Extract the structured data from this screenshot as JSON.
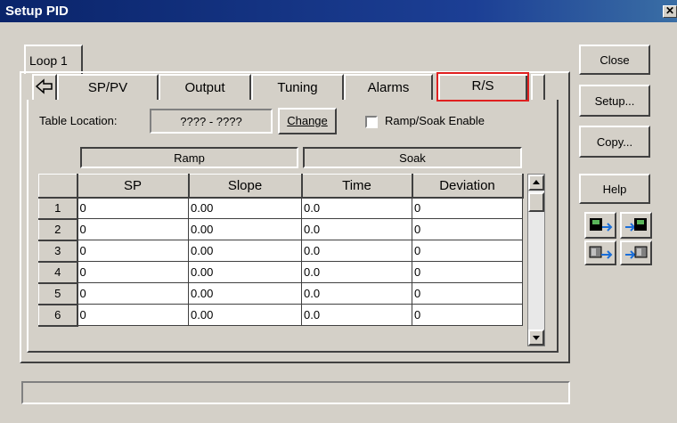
{
  "window": {
    "title": "Setup PID"
  },
  "loop_tab": {
    "label": "Loop 1"
  },
  "tabs": {
    "back_icon": "back-arrow-icon",
    "items": [
      {
        "label": "SP/PV"
      },
      {
        "label": "Output"
      },
      {
        "label": "Tuning"
      },
      {
        "label": "Alarms"
      },
      {
        "label": "R/S"
      }
    ],
    "active": "R/S",
    "highlight_color": "#e02020"
  },
  "table_location": {
    "label": "Table Location:",
    "value": "???? - ????",
    "change_label": "Change"
  },
  "ramp_soak": {
    "label": "Ramp/Soak Enable",
    "checked": false
  },
  "grid": {
    "groups": {
      "ramp": "Ramp",
      "soak": "Soak"
    },
    "columns": [
      "SP",
      "Slope",
      "Time",
      "Deviation"
    ],
    "rows": [
      {
        "num": "1",
        "sp": "0",
        "slope": "0.00",
        "time": "0.0",
        "dev": "0"
      },
      {
        "num": "2",
        "sp": "0",
        "slope": "0.00",
        "time": "0.0",
        "dev": "0"
      },
      {
        "num": "3",
        "sp": "0",
        "slope": "0.00",
        "time": "0.0",
        "dev": "0"
      },
      {
        "num": "4",
        "sp": "0",
        "slope": "0.00",
        "time": "0.0",
        "dev": "0"
      },
      {
        "num": "5",
        "sp": "0",
        "slope": "0.00",
        "time": "0.0",
        "dev": "0"
      },
      {
        "num": "6",
        "sp": "0",
        "slope": "0.00",
        "time": "0.0",
        "dev": "0"
      }
    ]
  },
  "buttons": {
    "close": "Close",
    "setup": "Setup...",
    "copy": "Copy...",
    "help": "Help"
  },
  "icon_buttons": [
    "load-from-disk-icon",
    "save-to-disk-icon",
    "load-from-controller-icon",
    "save-to-controller-icon"
  ],
  "status_bar": {
    "text": ""
  }
}
